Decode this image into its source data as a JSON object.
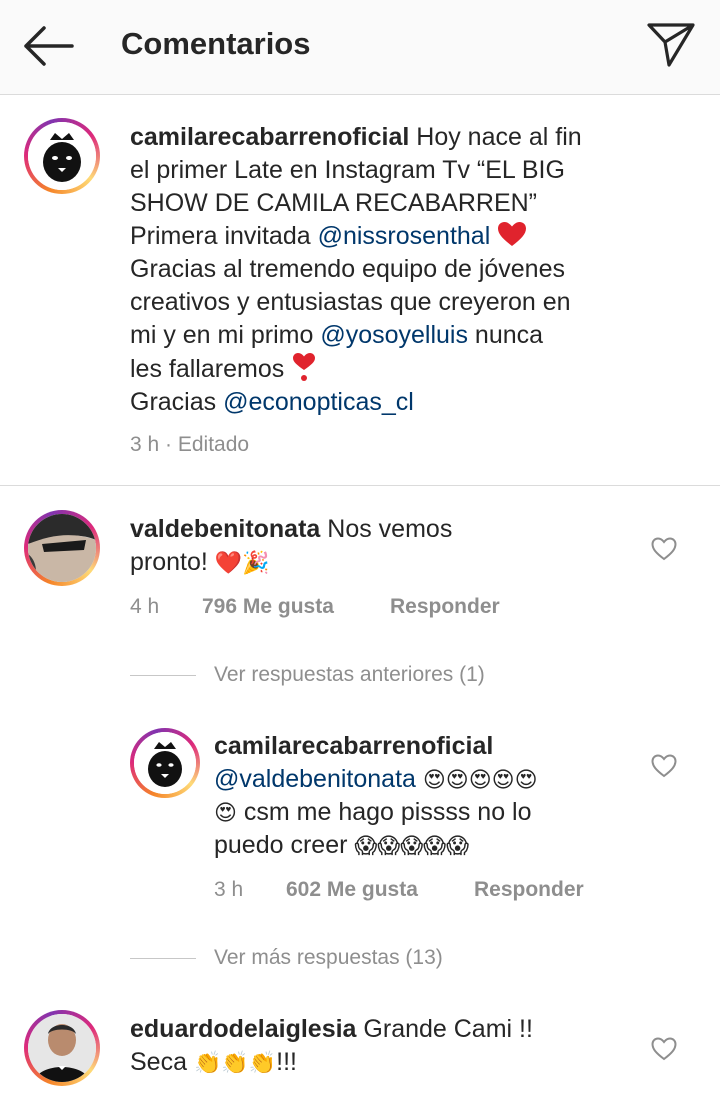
{
  "header": {
    "title": "Comentarios"
  },
  "caption": {
    "username": "camilarecabarrenoficial",
    "lines": [
      "Hoy nace al fin",
      "el primer Late en Instagram Tv “EL BIG",
      "SHOW DE CAMILA RECABARREN”",
      "Primera invitada ",
      "Gracias al tremendo equipo de jóvenes",
      "creativos y entusiastas que creyeron en",
      "mi y en mi primo ",
      " nunca",
      "les fallaremos ",
      "Gracias "
    ],
    "mentions": [
      "@nissrosenthal",
      "@yosoyelluis",
      "@econopticas_cl"
    ],
    "time": "3 h · Editado"
  },
  "comments": [
    {
      "username": "valdebenitonata",
      "text_1": "Nos vemos",
      "text_2": "pronto! ",
      "emojis": "❤️🎉",
      "time": "4 h",
      "likes": "796 Me gusta",
      "reply": "Responder"
    },
    {
      "view_previous": "Ver respuestas anteriores (1)",
      "username": "camilarecabarrenoficial",
      "mention": "@valdebenitonata",
      "emojis_1": "😍😍😍😍😍",
      "emoji_2": "😍",
      "text_1": " csm me hago pissss no lo",
      "text_2": "puedo creer ",
      "emojis_3": "😱😱😱😱😱",
      "time": "3 h",
      "likes": "602 Me gusta",
      "reply": "Responder",
      "view_more": "Ver más respuestas (13)"
    },
    {
      "username": "eduardodelaiglesia",
      "text_1": "Grande Cami !!",
      "text_2": "Seca ",
      "emojis": "👏👏👏",
      "text_3": "!!!"
    }
  ],
  "icons": {
    "back": "arrow-left-icon",
    "send": "direct-send-icon",
    "like": "heart-outline-icon"
  },
  "colors": {
    "mention": "#00376b",
    "meta": "#8e8e8e",
    "heart": "#ed4956"
  }
}
